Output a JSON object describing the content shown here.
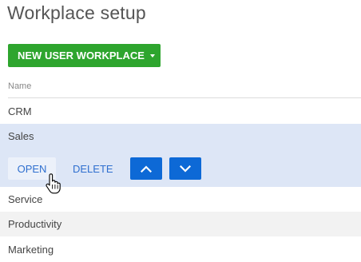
{
  "page": {
    "title": "Workplace setup"
  },
  "toolbar": {
    "new_workplace_label": "NEW USER WORKPLACE"
  },
  "list": {
    "column_header": "Name",
    "items": [
      {
        "label": "CRM"
      },
      {
        "label": "Sales"
      },
      {
        "label": "Service"
      },
      {
        "label": "Productivity"
      },
      {
        "label": "Marketing"
      }
    ],
    "selected_index": 1
  },
  "row_actions": {
    "open_label": "OPEN",
    "delete_label": "DELETE",
    "move_up_icon": "chevron-up-icon",
    "move_down_icon": "chevron-down-icon"
  },
  "colors": {
    "primary_green": "#2ea52e",
    "action_blue": "#0d69d6",
    "link_blue": "#2f6fcf",
    "selected_row": "#dde6f6",
    "alt_row": "#f2f2f2"
  }
}
